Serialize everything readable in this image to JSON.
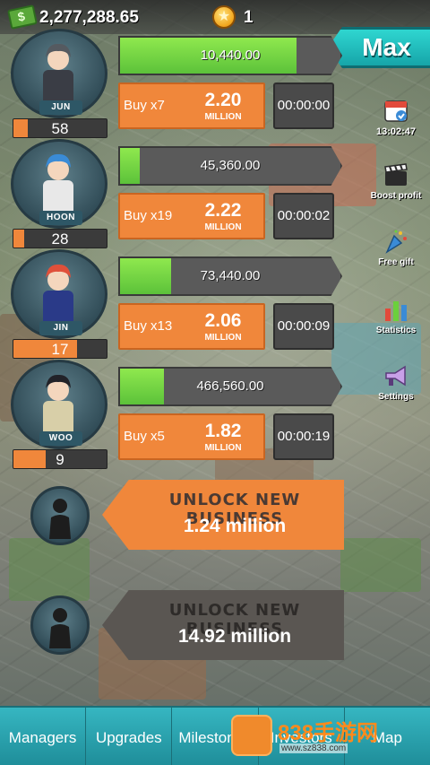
{
  "header": {
    "cash": "2,277,288.65",
    "stars": "1",
    "max_label": "Max"
  },
  "businesses": [
    {
      "name": "JUN",
      "level": "58",
      "level_fraction": 0.15,
      "revenue": "10,440.00",
      "progress_fraction": 0.8,
      "buy_label": "Buy x7",
      "price": "2.20",
      "price_unit": "MILLION",
      "timer": "00:00:00",
      "hair_color": "#555a60",
      "outfit_color": "#3a3d45"
    },
    {
      "name": "HOON",
      "level": "28",
      "level_fraction": 0.12,
      "revenue": "45,360.00",
      "progress_fraction": 0.09,
      "buy_label": "Buy x19",
      "price": "2.22",
      "price_unit": "MILLION",
      "timer": "00:00:02",
      "hair_color": "#3a8bd6",
      "outfit_color": "#e8e8e8"
    },
    {
      "name": "JIN",
      "level": "17",
      "level_fraction": 0.68,
      "revenue": "73,440.00",
      "progress_fraction": 0.23,
      "buy_label": "Buy x13",
      "price": "2.06",
      "price_unit": "MILLION",
      "timer": "00:00:09",
      "hair_color": "#e0503a",
      "outfit_color": "#2a3a88"
    },
    {
      "name": "WOO",
      "level": "9",
      "level_fraction": 0.35,
      "revenue": "466,560.00",
      "progress_fraction": 0.2,
      "buy_label": "Buy x5",
      "price": "1.82",
      "price_unit": "MILLION",
      "timer": "00:00:19",
      "hair_color": "#222228",
      "outfit_color": "#d8cfa8"
    }
  ],
  "side_menu": {
    "time": "13:02:47",
    "boost_profit": "Boost profit",
    "free_gift": "Free gift",
    "statistics": "Statistics",
    "settings": "Settings"
  },
  "unlock": [
    {
      "title": "UNLOCK NEW BUSINESS",
      "price": "1.24 million",
      "color": "#f0873b",
      "title_color": "#4a3a33"
    },
    {
      "title": "UNLOCK NEW BUSINESS",
      "price": "14.92 million",
      "color": "#5a5652",
      "title_color": "#2e2b29"
    }
  ],
  "nav": {
    "managers": "Managers",
    "upgrades": "Upgrades",
    "milestones": "Milestones",
    "investors": "Investors",
    "map": "Map"
  },
  "watermark": {
    "text": "838手游网",
    "url": "www.sz838.com"
  },
  "colors": {
    "accent_orange": "#f0873b",
    "progress_green": "#6bd03c",
    "teal": "#1f8e9a"
  }
}
